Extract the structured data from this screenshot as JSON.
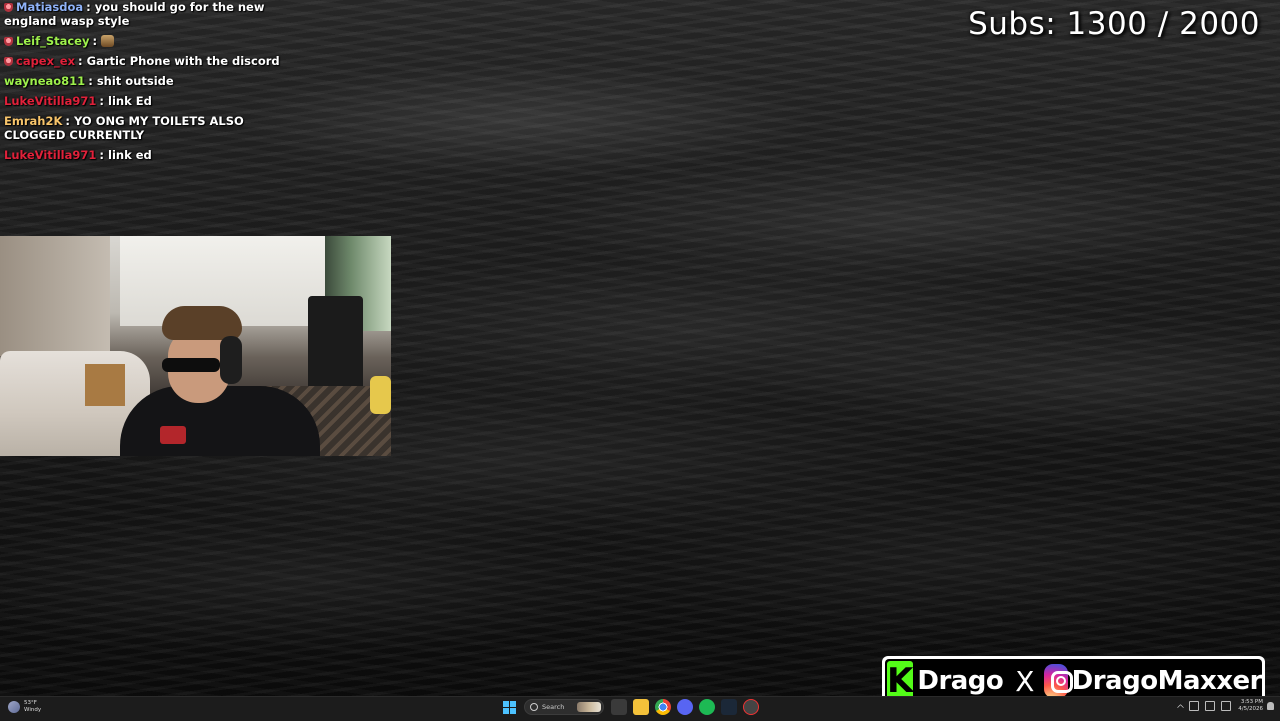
{
  "chat": {
    "messages": [
      {
        "user": "Matiasdoa",
        "user_color": "#8fb2f7",
        "badge": true,
        "text": "you should go for the new england wasp style",
        "emote": false
      },
      {
        "user": "Leif_Stacey",
        "user_color": "#9ef04c",
        "badge": true,
        "text": "",
        "emote": true
      },
      {
        "user": "capex_ex",
        "user_color": "#e0213a",
        "badge": true,
        "text": "Gartic Phone with the discord",
        "emote": false
      },
      {
        "user": "wayneao811",
        "user_color": "#9ef04c",
        "badge": false,
        "text": "shit outside",
        "emote": false
      },
      {
        "user": "LukeVitilla971",
        "user_color": "#e0213a",
        "badge": false,
        "text": "link Ed",
        "emote": false
      },
      {
        "user": "Emrah2K",
        "user_color": "#f7c46a",
        "badge": false,
        "text": "YO ONG MY TOILETS ALSO CLOGGED CURRENTLY",
        "emote": false
      },
      {
        "user": "LukeVitilla971",
        "user_color": "#e0213a",
        "badge": false,
        "text": "link ed",
        "emote": false
      }
    ]
  },
  "subs": {
    "text": "Subs: 1300 / 2000",
    "current": 1300,
    "goal": 2000
  },
  "brand": {
    "kick_letter": "K",
    "kick_name": "Drago",
    "separator": "X",
    "instagram_name": "DragoMaxxer",
    "kick_color": "#53fc18"
  },
  "taskbar": {
    "weather_temp": "53°F",
    "weather_desc": "Windy",
    "search_placeholder": "Search",
    "apps": [
      "file-explorer-icon",
      "chrome-icon",
      "discord-icon",
      "spotify-icon",
      "steam-icon",
      "obs-icon"
    ],
    "time": "3:53 PM",
    "date": "4/5/2026"
  }
}
